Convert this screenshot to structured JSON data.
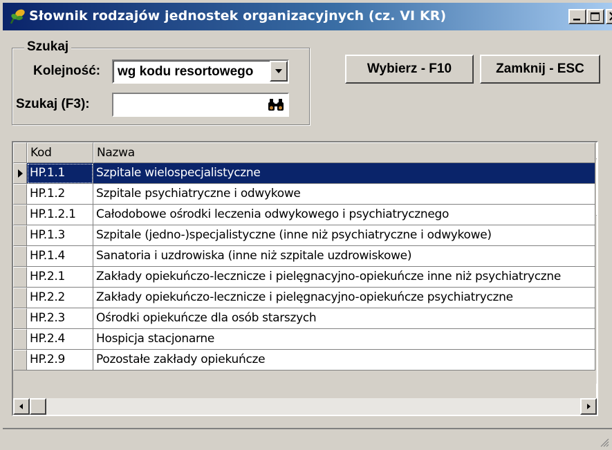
{
  "window": {
    "title": "Słownik rodzajów jednostek organizacyjnych (cz. VI KR)",
    "icons": {
      "app": "leaf-app-icon",
      "minimize": "minimize-icon",
      "maximize": "maximize-icon",
      "close": "close-icon"
    }
  },
  "search": {
    "group_title": "Szukaj",
    "order_label": "Kolejność:",
    "order_value": "wg kodu resortowego",
    "search_label": "Szukaj (F3):",
    "search_value": "",
    "search_icon": "binoculars-icon"
  },
  "buttons": {
    "select": "Wybierz - F10",
    "close": "Zamknij - ESC"
  },
  "grid": {
    "columns": [
      "Kod",
      "Nazwa"
    ],
    "rows": [
      {
        "kod": "HP.1.1",
        "nazwa": "Szpitale wielospecjalistyczne"
      },
      {
        "kod": "HP.1.2",
        "nazwa": "Szpitale psychiatryczne i odwykowe"
      },
      {
        "kod": "HP.1.2.1",
        "nazwa": "Całodobowe ośrodki leczenia odwykowego i psychiatrycznego"
      },
      {
        "kod": "HP.1.3",
        "nazwa": "Szpitale (jedno-)specjalistyczne (inne niż psychiatryczne i odwykowe)"
      },
      {
        "kod": "HP.1.4",
        "nazwa": "Sanatoria i uzdrowiska (inne niż szpitale uzdrowiskowe)"
      },
      {
        "kod": "HP.2.1",
        "nazwa": "Zakłady opiekuńczo-lecznicze i pielęgnacyjno-opiekuńcze inne niż psychiatryczne"
      },
      {
        "kod": "HP.2.2",
        "nazwa": "Zakłady opiekuńczo-lecznicze i pielęgnacyjno-opiekuńcze psychiatryczne"
      },
      {
        "kod": "HP.2.3",
        "nazwa": "Ośrodki opiekuńcze dla osób starszych"
      },
      {
        "kod": "HP.2.4",
        "nazwa": "Hospicja stacjonarne"
      },
      {
        "kod": "HP.2.9",
        "nazwa": "Pozostałe zakłady opiekuńcze"
      }
    ],
    "selected_row": 0
  },
  "colors": {
    "selection": "#0a246a",
    "face": "#d4d0c8",
    "title_start": "#0a246a",
    "title_end": "#a6caf0"
  }
}
